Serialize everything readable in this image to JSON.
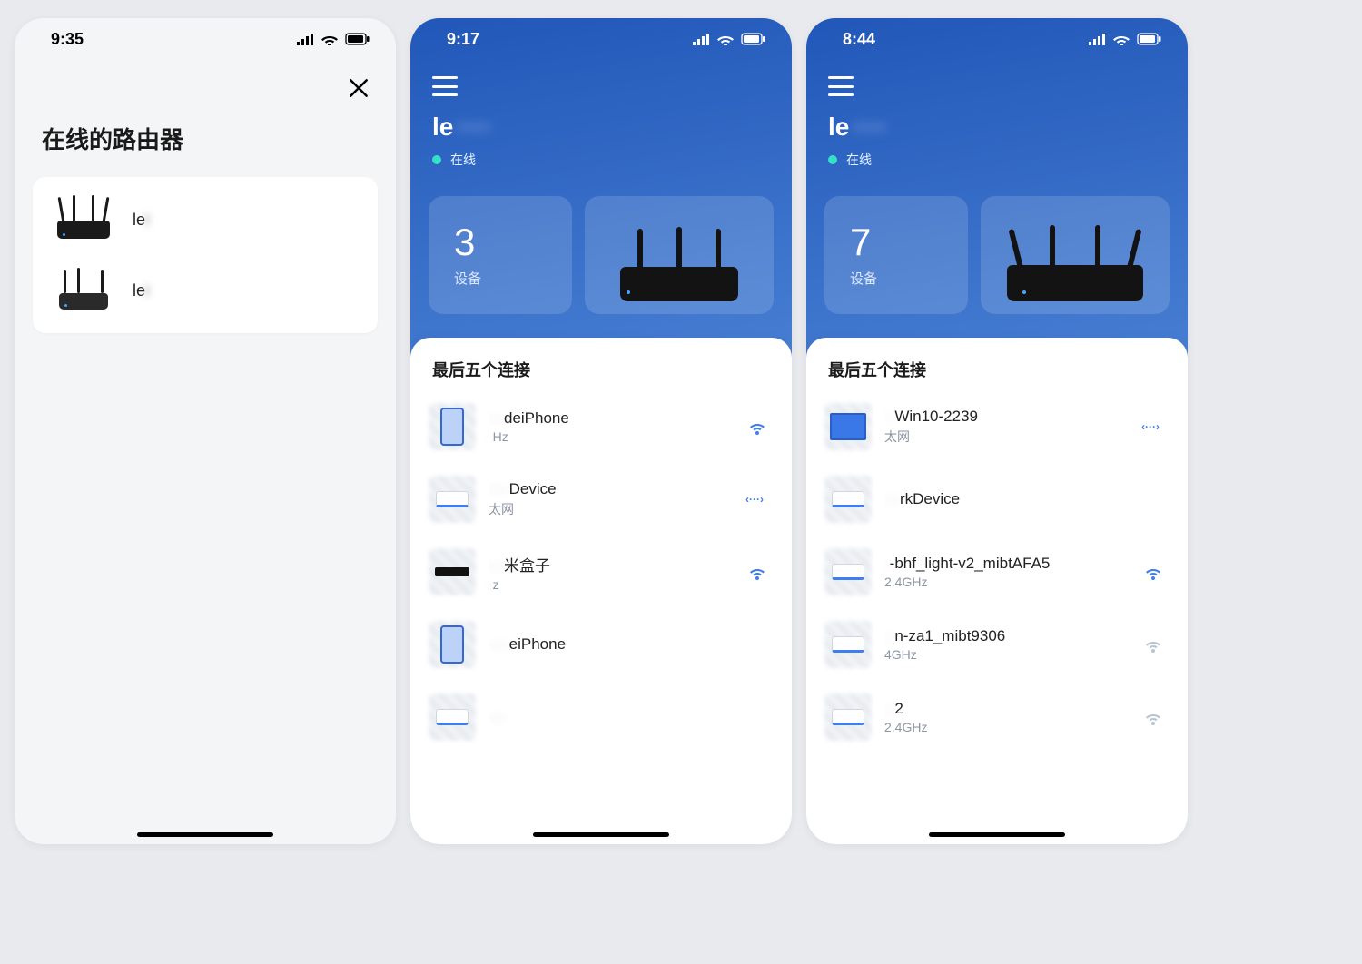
{
  "screens": {
    "list": {
      "time": "9:35",
      "title": "在线的路由器",
      "routers": [
        {
          "name": "le",
          "suffix": "i"
        },
        {
          "name": "le",
          "suffix": "i"
        }
      ]
    },
    "dash1": {
      "time": "9:17",
      "name_prefix": "le",
      "online_label": "在线",
      "device_count": "3",
      "device_label": "设备",
      "section_title": "最后五个连接",
      "devices": [
        {
          "icon": "phone-ico",
          "name_hidden": "···",
          "name_vis": "deiPhone",
          "sub_hidden": "·",
          "sub_vis": "Hz",
          "conn": "wifi"
        },
        {
          "icon": "generic-ico",
          "name_hidden": "····",
          "name_vis": "Device",
          "sub_hidden": "",
          "sub_vis": "太网",
          "conn": "eth"
        },
        {
          "icon": "box-ico",
          "name_hidden": "···",
          "name_vis": "米盒子",
          "sub_hidden": "·",
          "sub_vis": "z",
          "conn": "wifi"
        },
        {
          "icon": "phone-ico",
          "name_hidden": "····",
          "name_vis": "eiPhone",
          "sub_hidden": "",
          "sub_vis": "",
          "conn": ""
        },
        {
          "icon": "generic-ico",
          "name_hidden": "···",
          "name_vis": "",
          "sub_hidden": "",
          "sub_vis": "",
          "conn": ""
        }
      ]
    },
    "dash2": {
      "time": "8:44",
      "name_prefix": "le",
      "online_label": "在线",
      "device_count": "7",
      "device_label": "设备",
      "section_title": "最后五个连接",
      "devices": [
        {
          "icon": "pc-ico",
          "name_hidden": "··",
          "name_vis": "Win10-2239",
          "sub_hidden": "",
          "sub_vis": "太网",
          "conn": "eth"
        },
        {
          "icon": "generic-ico",
          "name_hidden": "···",
          "name_vis": "rkDevice",
          "sub_hidden": "",
          "sub_vis": "",
          "conn": ""
        },
        {
          "icon": "generic-ico",
          "name_hidden": "·",
          "name_vis": "-bhf_light-v2_mibtAFA5",
          "sub_hidden": "",
          "sub_vis": "2.4GHz",
          "conn": "wifi"
        },
        {
          "icon": "generic-ico",
          "name_hidden": "··",
          "name_vis": "n-za1_mibt9306",
          "sub_hidden": "",
          "sub_vis": "4GHz",
          "conn": "wifi-dim"
        },
        {
          "icon": "generic-ico",
          "name_hidden": "··",
          "name_vis": "2",
          "sub_hidden": "",
          "sub_vis": "2.4GHz",
          "conn": "wifi-dim"
        }
      ]
    }
  }
}
